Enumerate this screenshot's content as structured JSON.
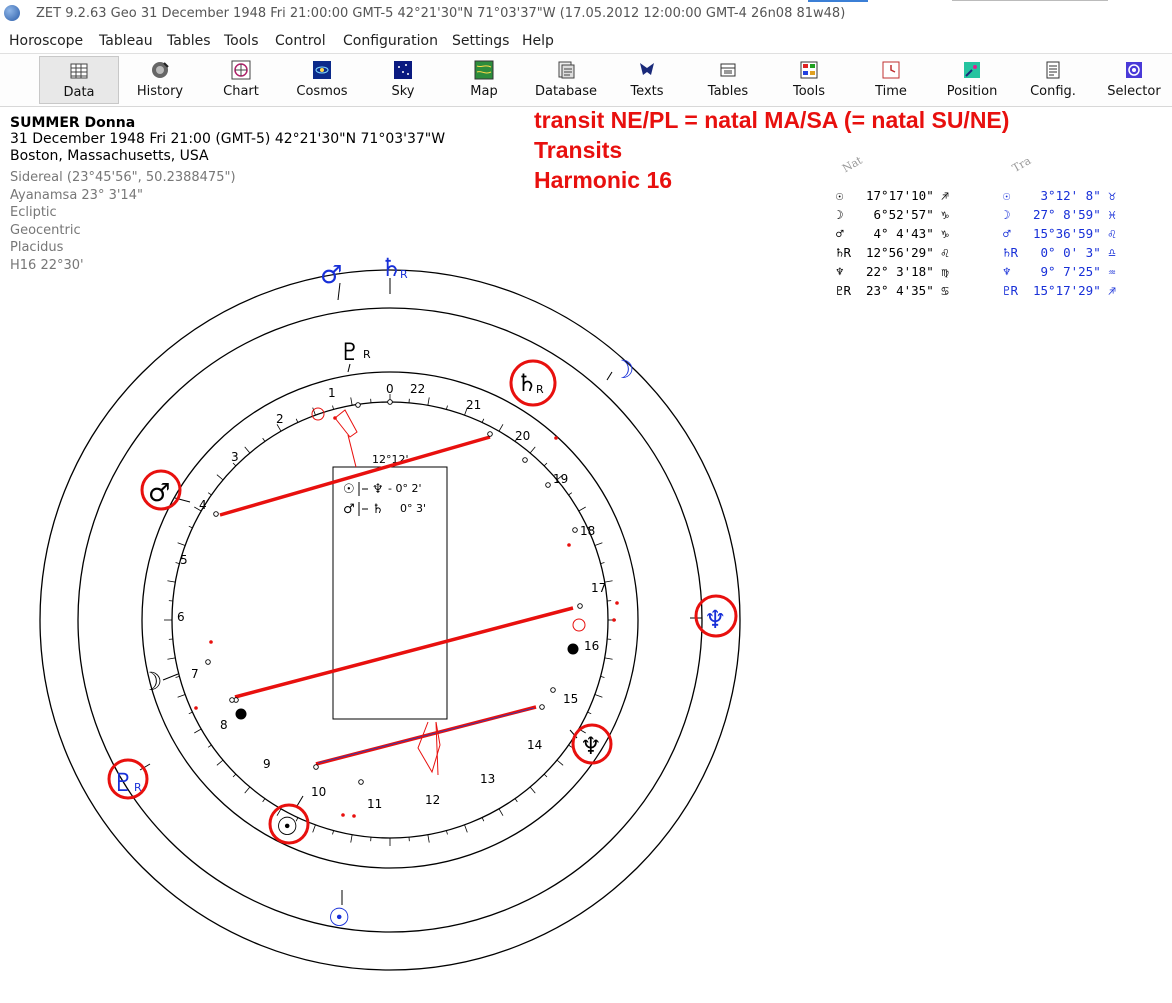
{
  "window": {
    "title": "ZET 9.2.63 Geo   31 December 1948  Fri  21:00:00 GMT-5 42°21'30\"N  71°03'37\"W  (17.05.2012  12:00:00 GMT-4 26n08 81w48)"
  },
  "menu": [
    "Horoscope",
    "Tableau",
    "Tables",
    "Tools",
    "Control",
    "Configuration",
    "Settings",
    "Help"
  ],
  "toolbar": [
    {
      "label": "Data",
      "icon": "data-grid-icon",
      "active": true
    },
    {
      "label": "History",
      "icon": "history-icon"
    },
    {
      "label": "Chart",
      "icon": "chart-wheel-icon"
    },
    {
      "label": "Cosmos",
      "icon": "cosmos-icon"
    },
    {
      "label": "Sky",
      "icon": "sky-icon"
    },
    {
      "label": "Map",
      "icon": "map-icon"
    },
    {
      "label": "Database",
      "icon": "database-icon"
    },
    {
      "label": "Texts",
      "icon": "texts-icon"
    },
    {
      "label": "Tables",
      "icon": "tables-icon"
    },
    {
      "label": "Tools",
      "icon": "tools-icon"
    },
    {
      "label": "Time",
      "icon": "time-icon"
    },
    {
      "label": "Position",
      "icon": "position-icon"
    },
    {
      "label": "Config.",
      "icon": "config-icon"
    },
    {
      "label": "Selector",
      "icon": "selector-icon"
    }
  ],
  "info": {
    "name": "SUMMER Donna",
    "date_line": "31 December 1948  Fri  21:00 (GMT-5) 42°21'30\"N  71°03'37\"W",
    "place": "Boston, Massachusetts, USA",
    "details": [
      "Sidereal (23°45'56\", 50.2388475\")",
      "Ayanamsa 23° 3'14\"",
      "Ecliptic",
      "Geocentric",
      "Placidus",
      "H16  22°30'"
    ]
  },
  "headline": [
    "transit NE/PL = natal MA/SA (= natal SU/NE)",
    "Transits",
    "Harmonic 16"
  ],
  "positions": {
    "nat_header": "Nat",
    "tra_header": "Tra",
    "rows": [
      {
        "ng": "☉",
        "nv": "17°17'10\"",
        "ns": "♐",
        "tg": "☉",
        "tv": " 3°12' 8\"",
        "ts": "♉"
      },
      {
        "ng": "☽",
        "nv": " 6°52'57\"",
        "ns": "♑",
        "tg": "☽",
        "tv": "27° 8'59\"",
        "ts": "♓"
      },
      {
        "ng": "♂",
        "nv": " 4° 4'43\"",
        "ns": "♑",
        "tg": "♂",
        "tv": "15°36'59\"",
        "ts": "♌"
      },
      {
        "ng": "♄R",
        "nv": "12°56'29\"",
        "ns": "♌",
        "tg": "♄R",
        "tv": " 0° 0' 3\"",
        "ts": "♎"
      },
      {
        "ng": "♆",
        "nv": "22° 3'18\"",
        "ns": "♍",
        "tg": "♆",
        "tv": " 9° 7'25\"",
        "ts": "♒"
      },
      {
        "ng": "♇R",
        "nv": "23° 4'35\"",
        "ns": "♋",
        "tg": "♇R",
        "tv": "15°17'29\"",
        "ts": "♐"
      }
    ]
  },
  "chart": {
    "house_numbers": [
      "0",
      "1",
      "2",
      "3",
      "4",
      "5",
      "6",
      "7",
      "8",
      "9",
      "10",
      "11",
      "12",
      "13",
      "14",
      "15",
      "16",
      "17",
      "18",
      "19",
      "20",
      "21",
      "22"
    ],
    "midpoint_box": {
      "header": "12°12'",
      "line1_a": "☉",
      "line1_b": "♆",
      "line1_value": "- 0° 2'",
      "line2_a": "♂",
      "line2_b": "♄",
      "line2_value": "0° 3'"
    },
    "transit_glyphs": [
      "♂",
      "♄",
      "☽",
      "♆",
      "♇",
      "☉"
    ],
    "natal_glyphs": [
      "♇",
      "♄",
      "♂",
      "☽",
      "♆",
      "☉"
    ],
    "retro_mark": "R"
  },
  "colors": {
    "red": "#e8100e",
    "blue": "#1830d8",
    "black": "#000000"
  }
}
